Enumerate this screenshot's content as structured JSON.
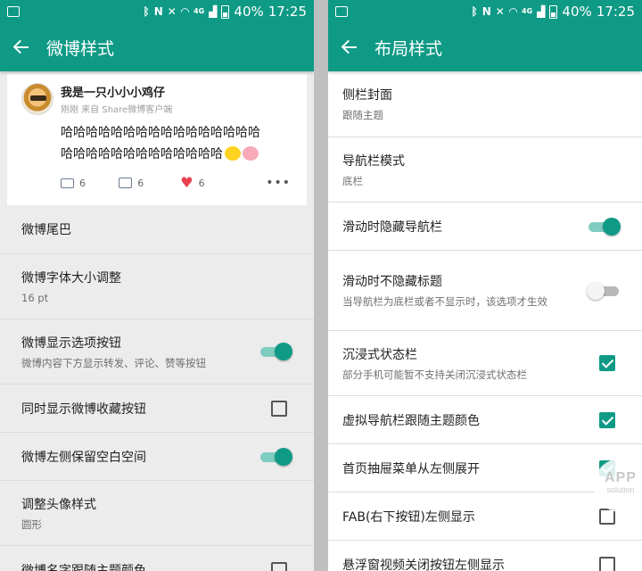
{
  "status_bar": {
    "battery": "40%",
    "time": "17:25",
    "network": "4G"
  },
  "left_screen": {
    "title": "微博样式",
    "preview": {
      "user_name": "我是一只小小小鸡仔",
      "meta": "刚刚 来自 Share微博客户端",
      "line1": "哈哈哈哈哈哈哈哈哈哈哈哈哈哈哈哈",
      "line2": "哈哈哈哈哈哈哈哈哈哈哈哈哈",
      "reposts": "6",
      "comments": "6",
      "likes": "6",
      "more": "•••"
    },
    "rows": [
      {
        "title": "微博尾巴"
      },
      {
        "title": "微博字体大小调整",
        "sub": "16 pt"
      },
      {
        "title": "微博显示选项按钮",
        "sub": "微博内容下方显示转发、评论、赞等按钮",
        "control": "switch",
        "state": "on"
      },
      {
        "title": "同时显示微博收藏按钮",
        "control": "checkbox",
        "state": "unchecked"
      },
      {
        "title": "微博左侧保留空白空间",
        "control": "switch",
        "state": "on"
      },
      {
        "title": "调整头像样式",
        "sub": "圆形"
      },
      {
        "title": "微博名字跟随主题颜色",
        "control": "checkbox",
        "state": "unchecked"
      }
    ]
  },
  "right_screen": {
    "title": "布局样式",
    "rows": [
      {
        "title": "侧栏封面",
        "sub": "跟随主题"
      },
      {
        "title": "导航栏模式",
        "sub": "底栏"
      },
      {
        "title": "滑动时隐藏导航栏",
        "control": "switch",
        "state": "on"
      },
      {
        "title": "滑动时不隐藏标题",
        "sub": "当导航栏为底栏或者不显示时，该选项才生效",
        "control": "switch",
        "state": "off"
      },
      {
        "title": "沉浸式状态栏",
        "sub": "部分手机可能暂不支持关闭沉浸式状态栏",
        "control": "checkbox",
        "state": "checked"
      },
      {
        "title": "虚拟导航栏跟随主题颜色",
        "control": "checkbox",
        "state": "checked"
      },
      {
        "title": "首页抽屉菜单从左侧展开",
        "control": "checkbox",
        "state": "checked"
      },
      {
        "title": "FAB(右下按钮)左侧显示",
        "control": "checkbox",
        "state": "unchecked"
      },
      {
        "title": "悬浮窗视频关闭按钮左侧显示",
        "control": "checkbox",
        "state": "unchecked"
      }
    ]
  },
  "watermark": {
    "line1": "APP",
    "line2": "solution"
  },
  "colors": {
    "accent": "#0f9a86",
    "like": "#e8424f"
  }
}
